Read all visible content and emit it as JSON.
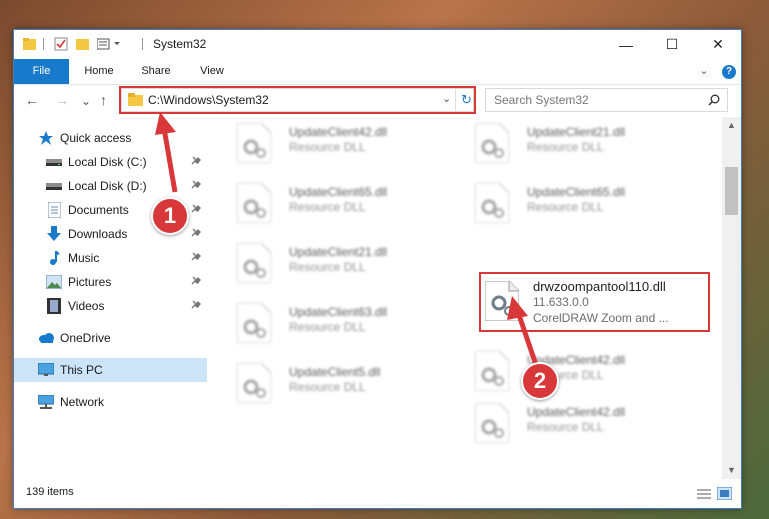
{
  "window": {
    "title": "System32",
    "controls": {
      "minimize": "—",
      "maximize": "☐",
      "close": "✕"
    }
  },
  "ribbon": {
    "tabs": [
      "File",
      "Home",
      "Share",
      "View"
    ],
    "expand_glyph": "⌄",
    "help_glyph": "?"
  },
  "navigation": {
    "back": "←",
    "forward": "→",
    "recent": "⌄",
    "up": "↑",
    "address": "C:\\Windows\\System32",
    "search_placeholder": "Search System32"
  },
  "sidebar": {
    "items": [
      {
        "label": "Quick access",
        "icon": "star-icon",
        "pinned": false
      },
      {
        "label": "Local Disk (C:)",
        "icon": "drive-icon",
        "pinned": true
      },
      {
        "label": "Local Disk (D:)",
        "icon": "drive-icon",
        "pinned": true
      },
      {
        "label": "Documents",
        "icon": "documents-icon",
        "pinned": true
      },
      {
        "label": "Downloads",
        "icon": "download-arrow-icon",
        "pinned": true
      },
      {
        "label": "Music",
        "icon": "music-note-icon",
        "pinned": true
      },
      {
        "label": "Pictures",
        "icon": "pictures-icon",
        "pinned": true
      },
      {
        "label": "Videos",
        "icon": "film-icon",
        "pinned": true
      },
      {
        "label": "OneDrive",
        "icon": "cloud-icon",
        "pinned": false
      },
      {
        "label": "This PC",
        "icon": "monitor-icon",
        "pinned": false,
        "selected": true
      },
      {
        "label": "Network",
        "icon": "network-icon",
        "pinned": false
      }
    ]
  },
  "files": {
    "left": [
      {
        "name": "UpdateClient42.dll",
        "desc": "Resource DLL"
      },
      {
        "name": "UpdateClient65.dll",
        "desc": "Resource DLL"
      },
      {
        "name": "UpdateClient21.dll",
        "desc": "Resource DLL"
      },
      {
        "name": "UpdateClient63.dll",
        "desc": "Resource DLL"
      },
      {
        "name": "UpdateClient5.dll",
        "desc": "Resource DLL"
      }
    ],
    "right": [
      {
        "name": "UpdateClient21.dll",
        "desc": "Resource DLL"
      },
      {
        "name": "UpdateClient65.dll",
        "desc": "Resource DLL"
      },
      {
        "name": "drwzoompantool110.dll",
        "version": "11.633.0.0",
        "desc": "CorelDRAW Zoom and ...",
        "highlighted": true
      },
      {
        "name": "UpdateClient42.dll",
        "desc": "Resource DLL"
      },
      {
        "name": "UpdateClient42.dll",
        "desc": "Resource DLL"
      }
    ]
  },
  "status": {
    "item_count": "139 items"
  },
  "callouts": [
    "1",
    "2"
  ],
  "colors": {
    "accent": "#1979ca",
    "highlight": "#d9383a",
    "selected": "#cce4f7"
  }
}
